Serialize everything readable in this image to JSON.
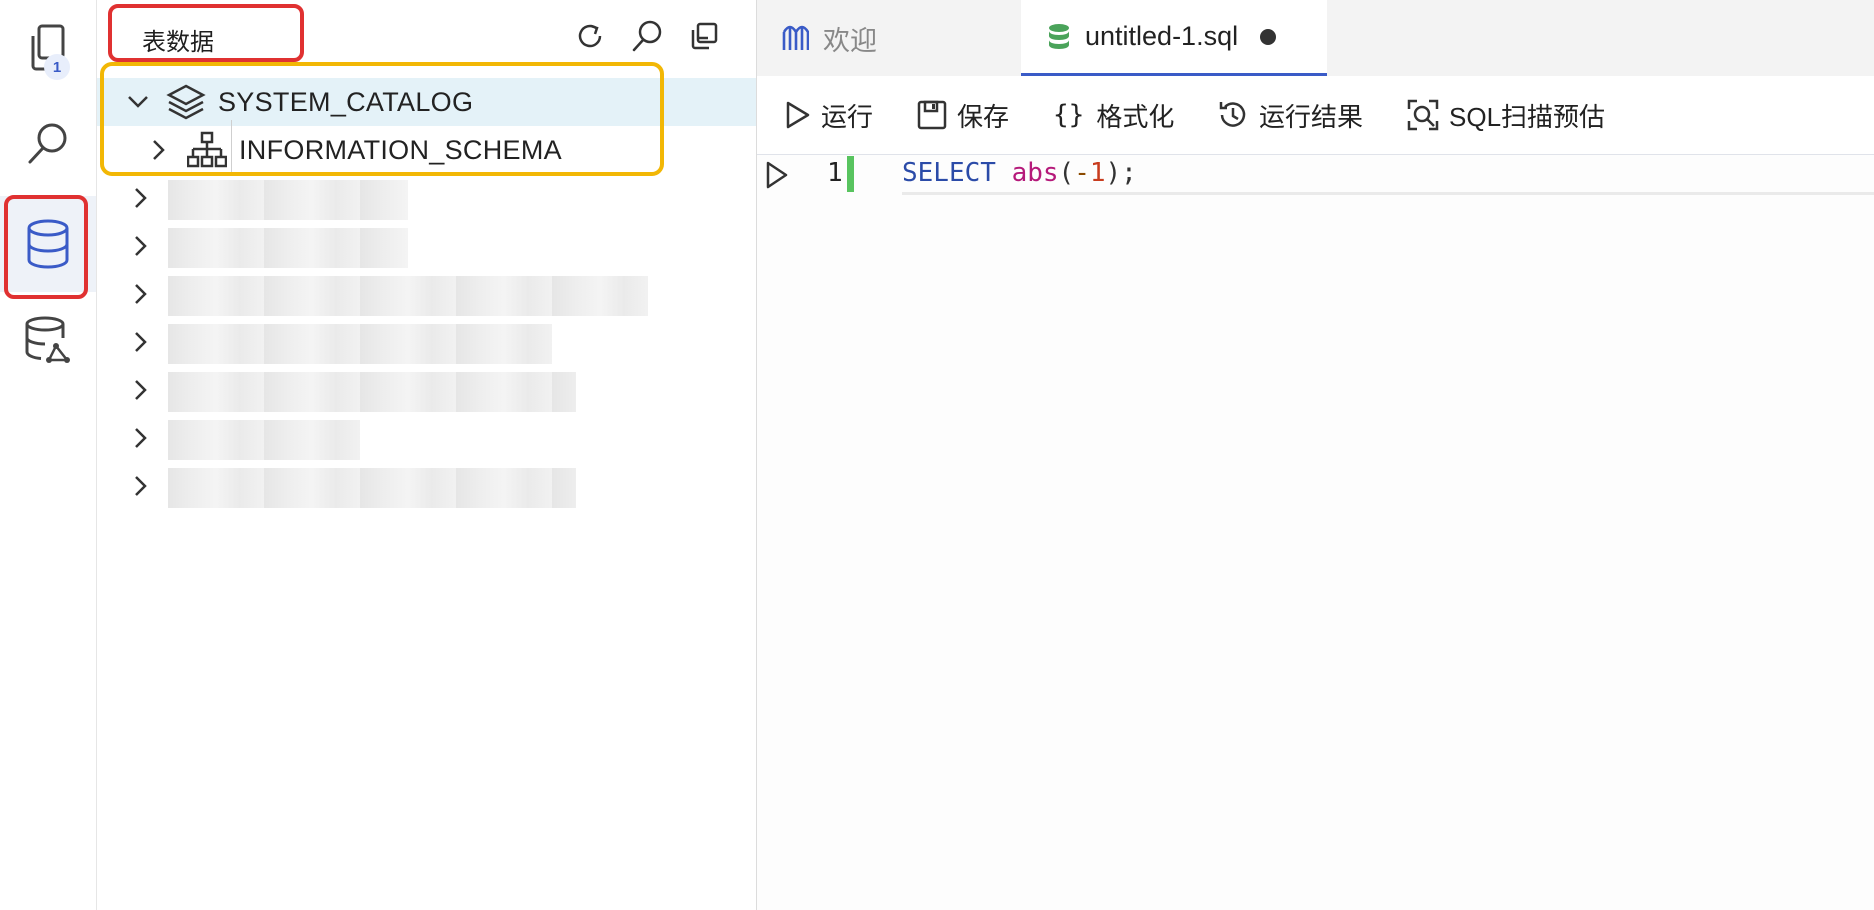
{
  "activity_bar": {
    "explorer_badge": "1",
    "items": [
      "files-icon",
      "search-icon",
      "database-icon",
      "database-network-icon"
    ]
  },
  "explorer": {
    "title": "表数据",
    "tree": [
      {
        "label": "SYSTEM_CATALOG",
        "expanded": true,
        "icon": "layers-icon"
      },
      {
        "label": "INFORMATION_SCHEMA",
        "expanded": false,
        "icon": "schema-icon"
      }
    ]
  },
  "tabs": [
    {
      "label": "欢迎",
      "icon": "welcome-logo-icon",
      "active": false
    },
    {
      "label": "untitled-1.sql",
      "icon": "database-icon",
      "active": true,
      "modified": true
    }
  ],
  "toolbar": {
    "run": "运行",
    "save": "保存",
    "format": "格式化",
    "results": "运行结果",
    "sql_scan": "SQL扫描预估"
  },
  "editor": {
    "line_number": "1",
    "code_keyword": "SELECT",
    "code_function": "abs",
    "code_open": "(",
    "code_minus": "-",
    "code_number": "1",
    "code_close": ");"
  },
  "colors": {
    "accent": "#3a5bc7",
    "red_highlight": "#e03131",
    "orange_highlight": "#f2b705",
    "selected_row": "#e4f2f8",
    "gutter_added": "#58c45f"
  }
}
